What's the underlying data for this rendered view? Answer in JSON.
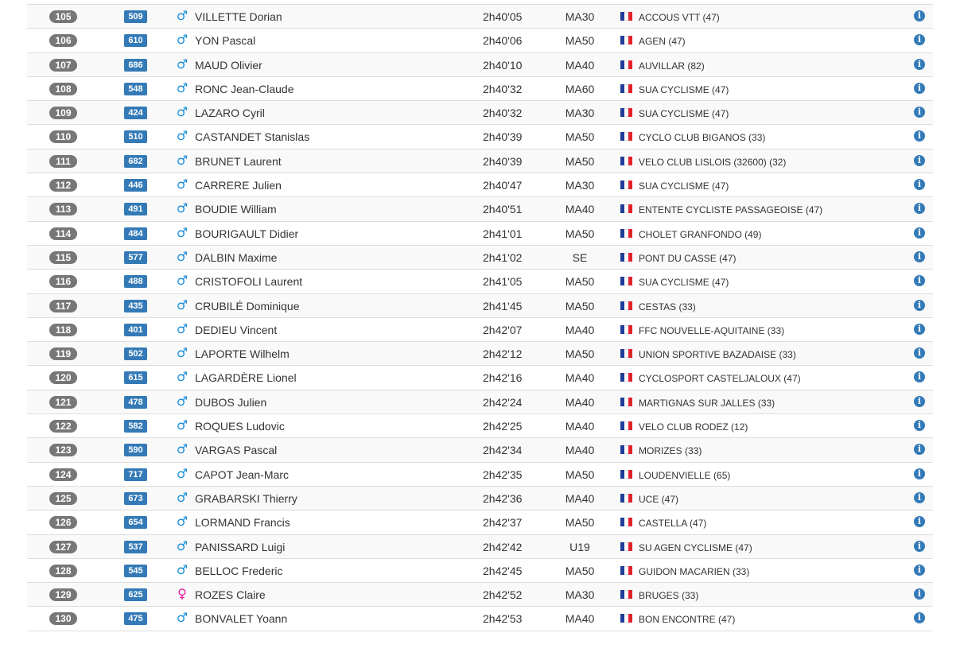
{
  "colors": {
    "position_badge": "#777777",
    "bib_badge": "#337ab7",
    "male_icon": "#1a8fd8",
    "female_icon": "#e91e9a",
    "info_icon": "#337ab7",
    "row_stripe": "#f9f9f9",
    "border": "#dddddd"
  },
  "icons": {
    "male": "♂",
    "female": "♀",
    "info": "i"
  },
  "rows": [
    {
      "pos": "105",
      "bib": "509",
      "gender": "male",
      "name": "VILLETTE Dorian",
      "time": "2h40'05",
      "cat": "MA30",
      "club": "ACCOUS VTT (47)"
    },
    {
      "pos": "106",
      "bib": "610",
      "gender": "male",
      "name": "YON Pascal",
      "time": "2h40'06",
      "cat": "MA50",
      "club": "AGEN (47)"
    },
    {
      "pos": "107",
      "bib": "686",
      "gender": "male",
      "name": "MAUD Olivier",
      "time": "2h40'10",
      "cat": "MA40",
      "club": "AUVILLAR (82)"
    },
    {
      "pos": "108",
      "bib": "548",
      "gender": "male",
      "name": "RONC Jean-Claude",
      "time": "2h40'32",
      "cat": "MA60",
      "club": "SUA CYCLISME (47)"
    },
    {
      "pos": "109",
      "bib": "424",
      "gender": "male",
      "name": "LAZARO Cyril",
      "time": "2h40'32",
      "cat": "MA30",
      "club": "SUA CYCLISME (47)"
    },
    {
      "pos": "110",
      "bib": "510",
      "gender": "male",
      "name": "CASTANDET Stanislas",
      "time": "2h40'39",
      "cat": "MA50",
      "club": "CYCLO CLUB BIGANOS (33)"
    },
    {
      "pos": "111",
      "bib": "682",
      "gender": "male",
      "name": "BRUNET Laurent",
      "time": "2h40'39",
      "cat": "MA50",
      "club": "VELO CLUB LISLOIS (32600) (32)"
    },
    {
      "pos": "112",
      "bib": "446",
      "gender": "male",
      "name": "CARRERE Julien",
      "time": "2h40'47",
      "cat": "MA30",
      "club": "SUA CYCLISME (47)"
    },
    {
      "pos": "113",
      "bib": "491",
      "gender": "male",
      "name": "BOUDIE William",
      "time": "2h40'51",
      "cat": "MA40",
      "club": "ENTENTE CYCLISTE PASSAGEOISE (47)"
    },
    {
      "pos": "114",
      "bib": "484",
      "gender": "male",
      "name": "BOURIGAULT Didier",
      "time": "2h41'01",
      "cat": "MA50",
      "club": "CHOLET GRANFONDO (49)"
    },
    {
      "pos": "115",
      "bib": "577",
      "gender": "male",
      "name": "DALBIN Maxime",
      "time": "2h41'02",
      "cat": "SE",
      "club": "PONT DU CASSE (47)"
    },
    {
      "pos": "116",
      "bib": "488",
      "gender": "male",
      "name": "CRISTOFOLI Laurent",
      "time": "2h41'05",
      "cat": "MA50",
      "club": "SUA CYCLISME (47)"
    },
    {
      "pos": "117",
      "bib": "435",
      "gender": "male",
      "name": "CRUBILÉ Dominique",
      "time": "2h41'45",
      "cat": "MA50",
      "club": "CESTAS (33)"
    },
    {
      "pos": "118",
      "bib": "401",
      "gender": "male",
      "name": "DEDIEU Vincent",
      "time": "2h42'07",
      "cat": "MA40",
      "club": "FFC NOUVELLE-AQUITAINE (33)"
    },
    {
      "pos": "119",
      "bib": "502",
      "gender": "male",
      "name": "LAPORTE Wilhelm",
      "time": "2h42'12",
      "cat": "MA50",
      "club": "UNION SPORTIVE BAZADAISE (33)"
    },
    {
      "pos": "120",
      "bib": "615",
      "gender": "male",
      "name": "LAGARDÈRE Lionel",
      "time": "2h42'16",
      "cat": "MA40",
      "club": "CYCLOSPORT CASTELJALOUX (47)"
    },
    {
      "pos": "121",
      "bib": "478",
      "gender": "male",
      "name": "DUBOS Julien",
      "time": "2h42'24",
      "cat": "MA40",
      "club": "MARTIGNAS SUR JALLES (33)"
    },
    {
      "pos": "122",
      "bib": "582",
      "gender": "male",
      "name": "ROQUES Ludovic",
      "time": "2h42'25",
      "cat": "MA40",
      "club": "VELO CLUB RODEZ (12)"
    },
    {
      "pos": "123",
      "bib": "590",
      "gender": "male",
      "name": "VARGAS Pascal",
      "time": "2h42'34",
      "cat": "MA40",
      "club": "MORIZES (33)"
    },
    {
      "pos": "124",
      "bib": "717",
      "gender": "male",
      "name": "CAPOT Jean-Marc",
      "time": "2h42'35",
      "cat": "MA50",
      "club": "LOUDENVIELLE (65)"
    },
    {
      "pos": "125",
      "bib": "673",
      "gender": "male",
      "name": "GRABARSKI Thierry",
      "time": "2h42'36",
      "cat": "MA40",
      "club": "UCE (47)"
    },
    {
      "pos": "126",
      "bib": "654",
      "gender": "male",
      "name": "LORMAND Francis",
      "time": "2h42'37",
      "cat": "MA50",
      "club": "CASTELLA (47)"
    },
    {
      "pos": "127",
      "bib": "537",
      "gender": "male",
      "name": "PANISSARD Luigi",
      "time": "2h42'42",
      "cat": "U19",
      "club": "SU AGEN CYCLISME (47)"
    },
    {
      "pos": "128",
      "bib": "545",
      "gender": "male",
      "name": "BELLOC Frederic",
      "time": "2h42'45",
      "cat": "MA50",
      "club": "GUIDON MACARIEN (33)"
    },
    {
      "pos": "129",
      "bib": "625",
      "gender": "female",
      "name": "ROZES Claire",
      "time": "2h42'52",
      "cat": "MA30",
      "club": "BRUGES (33)"
    },
    {
      "pos": "130",
      "bib": "475",
      "gender": "male",
      "name": "BONVALET Yoann",
      "time": "2h42'53",
      "cat": "MA40",
      "club": "BON ENCONTRE (47)"
    }
  ]
}
